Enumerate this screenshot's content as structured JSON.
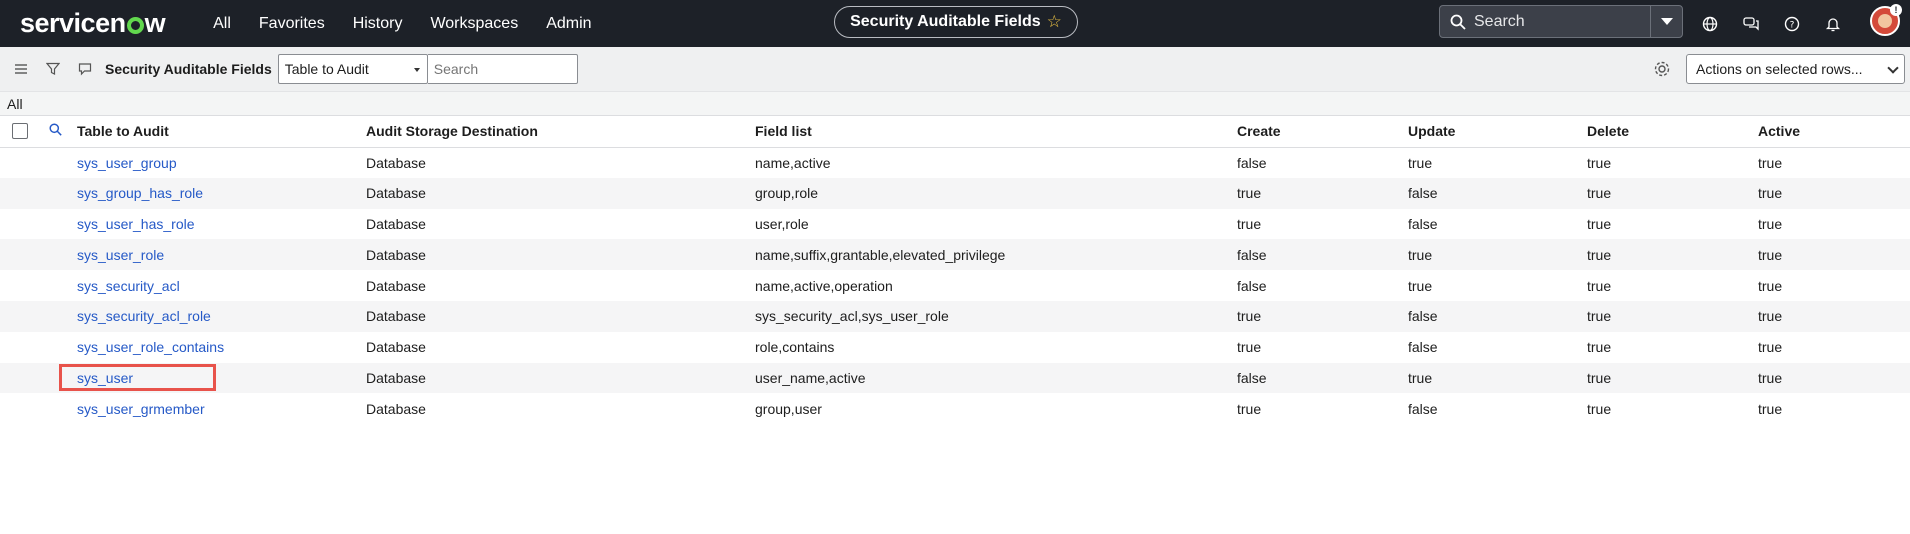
{
  "nav": {
    "brand": "servicenow",
    "menu": [
      "All",
      "Favorites",
      "History",
      "Workspaces",
      "Admin"
    ],
    "center_title": "Security Auditable Fields",
    "search_placeholder": "Search",
    "avatar_badge": "!"
  },
  "listbar": {
    "title": "Security Auditable Fields",
    "filter_field": "Table to Audit",
    "search_placeholder": "Search",
    "actions_label": "Actions on selected rows..."
  },
  "breadcrumb": "All",
  "table": {
    "columns": [
      "Table to Audit",
      "Audit Storage Destination",
      "Field list",
      "Create",
      "Update",
      "Delete",
      "Active"
    ],
    "rows": [
      [
        "sys_user_group",
        "Database",
        "name,active",
        "false",
        "true",
        "true",
        "true"
      ],
      [
        "sys_group_has_role",
        "Database",
        "group,role",
        "true",
        "false",
        "true",
        "true"
      ],
      [
        "sys_user_has_role",
        "Database",
        "user,role",
        "true",
        "false",
        "true",
        "true"
      ],
      [
        "sys_user_role",
        "Database",
        "name,suffix,grantable,elevated_privilege",
        "false",
        "true",
        "true",
        "true"
      ],
      [
        "sys_security_acl",
        "Database",
        "name,active,operation",
        "false",
        "true",
        "true",
        "true"
      ],
      [
        "sys_security_acl_role",
        "Database",
        "sys_security_acl,sys_user_role",
        "true",
        "false",
        "true",
        "true"
      ],
      [
        "sys_user_role_contains",
        "Database",
        "role,contains",
        "true",
        "false",
        "true",
        "true"
      ],
      [
        "sys_user",
        "Database",
        "user_name,active",
        "false",
        "true",
        "true",
        "true"
      ],
      [
        "sys_user_grmember",
        "Database",
        "group,user",
        "true",
        "false",
        "true",
        "true"
      ]
    ]
  },
  "colors": {
    "nav_bg": "#1d2128",
    "link": "#2559c7",
    "highlight": "#e8534b",
    "brand_green": "#62d84e"
  },
  "icons": [
    "search-icon",
    "globe-icon",
    "chat-icon",
    "help-icon",
    "bell-icon",
    "hamburger-icon",
    "filter-icon",
    "comment-icon",
    "gear-icon",
    "star-icon"
  ]
}
